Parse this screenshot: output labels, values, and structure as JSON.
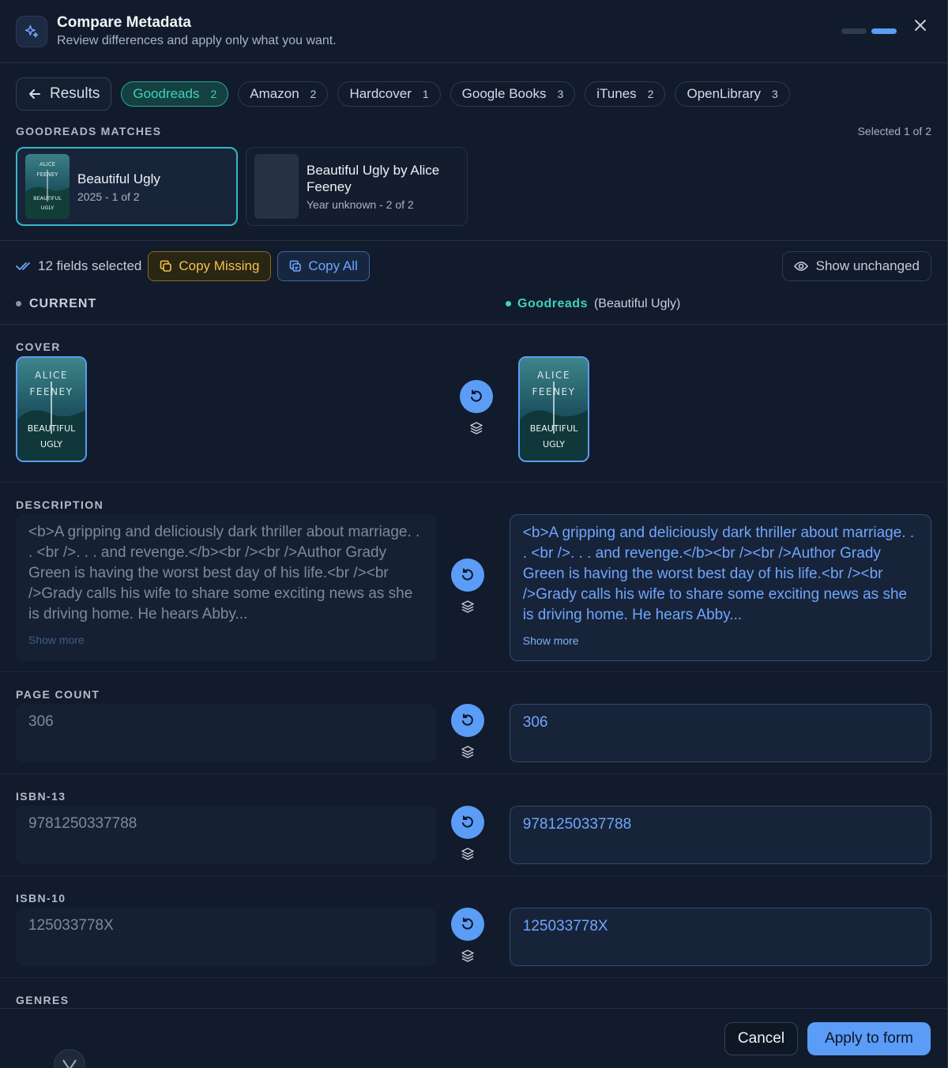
{
  "header": {
    "title": "Compare Metadata",
    "subtitle": "Review differences and apply only what you want.",
    "icon": "sparkles-icon",
    "close_icon": "close-icon",
    "step_current": 2,
    "step_total": 2
  },
  "tabs": {
    "results_label": "Results",
    "items": [
      {
        "label": "Goodreads",
        "count": "2",
        "active": true
      },
      {
        "label": "Amazon",
        "count": "2"
      },
      {
        "label": "Hardcover",
        "count": "1"
      },
      {
        "label": "Google Books",
        "count": "3"
      },
      {
        "label": "iTunes",
        "count": "2"
      },
      {
        "label": "OpenLibrary",
        "count": "3"
      }
    ]
  },
  "matches": {
    "heading": "GOODREADS MATCHES",
    "selected_text": "Selected 1 of 2",
    "items": [
      {
        "title": "Beautiful Ugly",
        "meta": "2025 - 1 of 2"
      },
      {
        "title": "Beautiful Ugly by Alice Feeney",
        "meta": "Year unknown - 2 of 2"
      }
    ]
  },
  "cover_art": {
    "author_line1": "ALICE",
    "author_line2": "FEENEY",
    "title_line1": "BEAUTIFUL",
    "title_line2": "UGLY"
  },
  "actions": {
    "fields_selected": "12 fields selected",
    "copy_missing": "Copy Missing",
    "copy_all": "Copy All",
    "show_unchanged": "Show unchanged"
  },
  "columns": {
    "current": "CURRENT",
    "source_name": "Goodreads",
    "source_book": "(Beautiful Ugly)"
  },
  "fields": {
    "cover": {
      "label": "COVER"
    },
    "description": {
      "label": "DESCRIPTION",
      "current": "<b>A gripping and deliciously dark thriller about marriage. . . <br />. . . and revenge.</b><br /><br />Author Grady Green is having the worst best day of his life.<br /><br />Grady calls his wife to share some exciting news as she is driving home. He hears Abby...",
      "new": "<b>A gripping and deliciously dark thriller about marriage. . . <br />. . . and revenge.</b><br /><br />Author Grady Green is having the worst best day of his life.<br /><br />Grady calls his wife to share some exciting news as she is driving home. He hears Abby...",
      "show_more": "Show more"
    },
    "page_count": {
      "label": "PAGE COUNT",
      "current": "306",
      "new": "306"
    },
    "isbn13": {
      "label": "ISBN-13",
      "current": "9781250337788",
      "new": "9781250337788"
    },
    "isbn10": {
      "label": "ISBN-10",
      "current": "125033778X",
      "new": "125033778X"
    },
    "genres": {
      "label": "GENRES"
    }
  },
  "footer": {
    "cancel": "Cancel",
    "apply": "Apply to form"
  },
  "colors": {
    "accent": "#5b9cf6",
    "goodreads": "#3fd1c0",
    "warning": "#f3c24a"
  }
}
